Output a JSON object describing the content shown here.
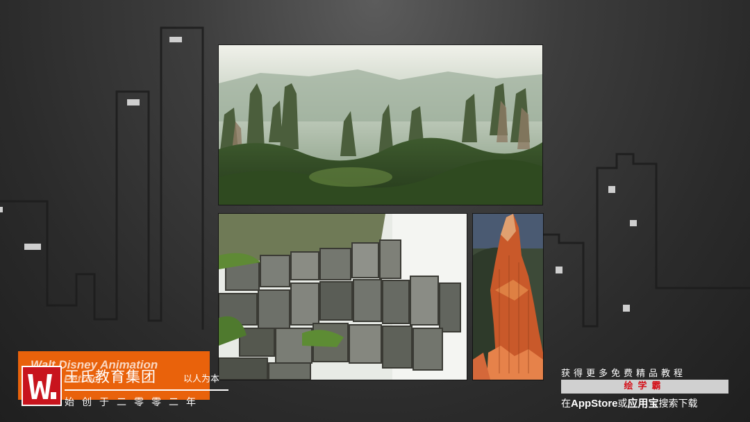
{
  "brand": {
    "ghost_title": "Walt Disney Animation",
    "ghost_subtitle": "Petroc",
    "name": "王氏教育集团",
    "motto": "以人为本",
    "founded": "始创于二零零二年"
  },
  "promo": {
    "line1": "获得更多免费精品教程",
    "app_name": "绘学霸",
    "line3_prefix": "在",
    "line3_store": "AppStore",
    "line3_or": "或",
    "line3_app": "应用宝",
    "line3_suffix": "搜索下载"
  },
  "photos": {
    "top": "karst-pillar-forest-photo",
    "bottom_left": "basalt-column-rocks-photo",
    "bottom_right": "red-rock-hoodoo-photo"
  },
  "colors": {
    "brand_orange": "#e9620b",
    "logo_red": "#c8141d",
    "promo_red": "#d4111a",
    "background": "#3a3a3a"
  }
}
